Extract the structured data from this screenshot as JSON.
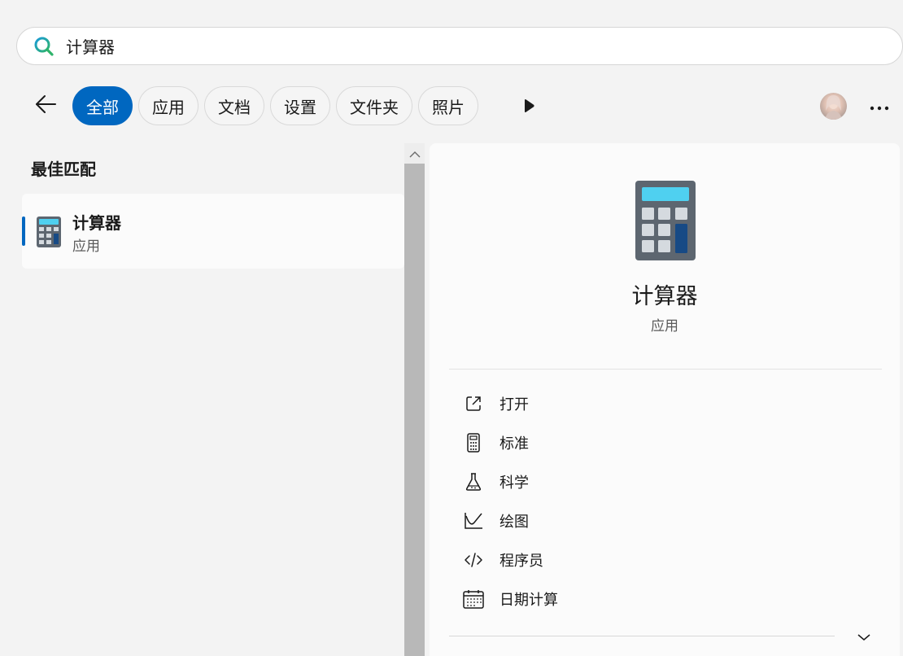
{
  "search": {
    "value": "计算器",
    "icon": "search-icon",
    "accent_colors": [
      "#1a9bd7",
      "#2fb36b"
    ]
  },
  "filters": {
    "chips": [
      {
        "label": "全部",
        "active": true
      },
      {
        "label": "应用",
        "active": false
      },
      {
        "label": "文档",
        "active": false
      },
      {
        "label": "设置",
        "active": false
      },
      {
        "label": "文件夹",
        "active": false
      },
      {
        "label": "照片",
        "active": false
      }
    ],
    "active_color": "#0067c0"
  },
  "results": {
    "section_heading": "最佳匹配",
    "best_match": {
      "title": "计算器",
      "subtitle": "应用",
      "icon": "calculator-icon"
    }
  },
  "details": {
    "title": "计算器",
    "subtitle": "应用",
    "icon": "calculator-icon",
    "actions": [
      {
        "label": "打开",
        "icon": "open-external-icon"
      },
      {
        "label": "标准",
        "icon": "calculator-outline-icon"
      },
      {
        "label": "科学",
        "icon": "flask-icon"
      },
      {
        "label": "绘图",
        "icon": "graph-icon"
      },
      {
        "label": "程序员",
        "icon": "code-icon"
      },
      {
        "label": "日期计算",
        "icon": "calendar-icon"
      }
    ]
  }
}
